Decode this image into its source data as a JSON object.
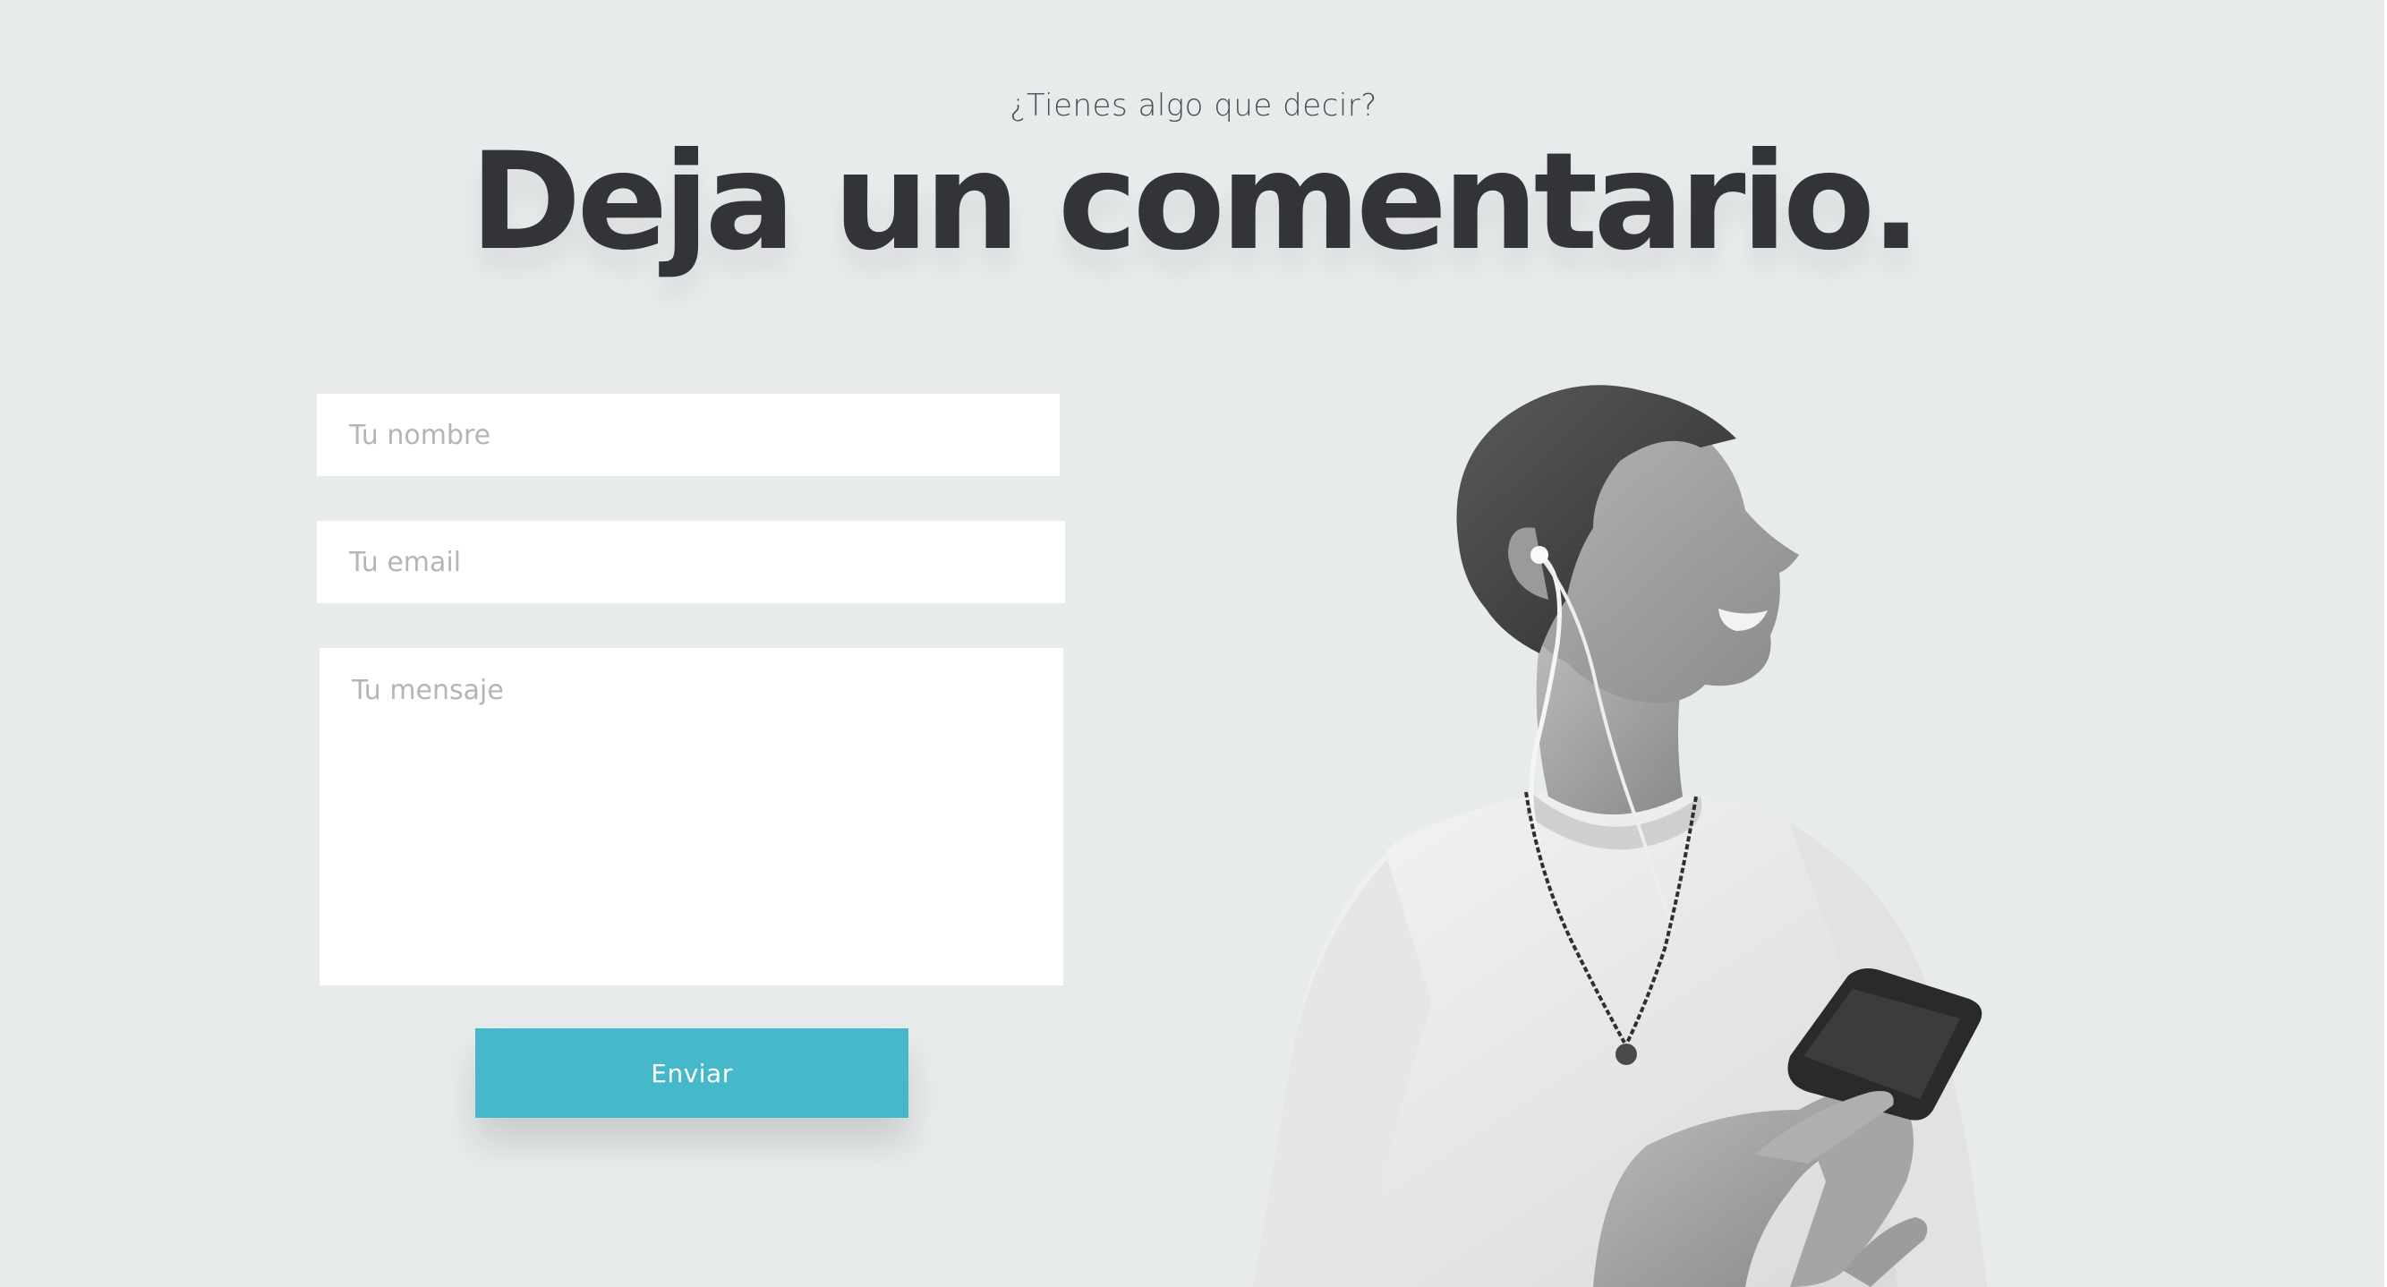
{
  "header": {
    "kicker": "¿Tienes algo que decir?",
    "title": "Deja un comentario."
  },
  "form": {
    "name_placeholder": "Tu nombre",
    "email_placeholder": "Tu email",
    "message_placeholder": "Tu mensaje",
    "submit_label": "Enviar"
  },
  "colors": {
    "background": "#e8ebec",
    "accent": "#45b8ca",
    "title": "#333437"
  },
  "image": {
    "icon": "person-with-phone-photo"
  }
}
